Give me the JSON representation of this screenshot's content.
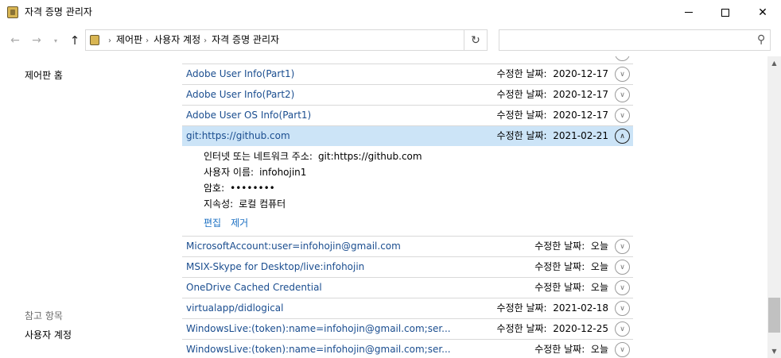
{
  "window": {
    "title": "자격 증명 관리자",
    "minimize_glyph": "",
    "close_glyph": "✕"
  },
  "address_bar": {
    "back_glyph": "←",
    "forward_glyph": "→",
    "recent_glyph": "▾",
    "up_glyph": "↑",
    "crumbs": [
      "제어판",
      "사용자 계정",
      "자격 증명 관리자"
    ],
    "crumb_sep": "›",
    "dropdown_glyph": "∨",
    "refresh_glyph": "↻",
    "search_placeholder": "",
    "search_glyph": "⚲"
  },
  "left_pane": {
    "home_link": "제어판 홈",
    "see_also": "참고 항목",
    "user_accounts_link": "사용자 계정"
  },
  "credentials": {
    "date_label": "수정한 날짜:",
    "rows": [
      {
        "name": "Adobe User Info(Part1)",
        "date": "2020-12-17"
      },
      {
        "name": "Adobe User Info(Part2)",
        "date": "2020-12-17"
      },
      {
        "name": "Adobe User OS Info(Part1)",
        "date": "2020-12-17"
      },
      {
        "name": "git:https://github.com",
        "date": "2021-02-21"
      },
      {
        "name": "MicrosoftAccount:user=infohojin@gmail.com",
        "date": "오늘"
      },
      {
        "name": "MSIX-Skype for Desktop/live:infohojin",
        "date": "오늘"
      },
      {
        "name": "OneDrive Cached Credential",
        "date": "오늘"
      },
      {
        "name": "virtualapp/didlogical",
        "date": "2021-02-18"
      },
      {
        "name": "WindowsLive:(token):name=infohojin@gmail.com;ser...",
        "date": "2020-12-25"
      },
      {
        "name": "WindowsLive:(token):name=infohojin@gmail.com;ser...",
        "date": "오늘"
      }
    ],
    "expanded": {
      "address_label": "인터넷 또는 네트워크 주소:",
      "address_value": "git:https://github.com",
      "username_label": "사용자 이름:",
      "username_value": "infohojin1",
      "password_label": "암호:",
      "password_value": "••••••••",
      "persistence_label": "지속성:",
      "persistence_value": "로컬 컴퓨터",
      "edit_link": "편집",
      "remove_link": "제거"
    },
    "chevron_down": "∨",
    "chevron_up": "∧"
  },
  "scrollbar": {
    "up_glyph": "▲",
    "down_glyph": "▼"
  }
}
